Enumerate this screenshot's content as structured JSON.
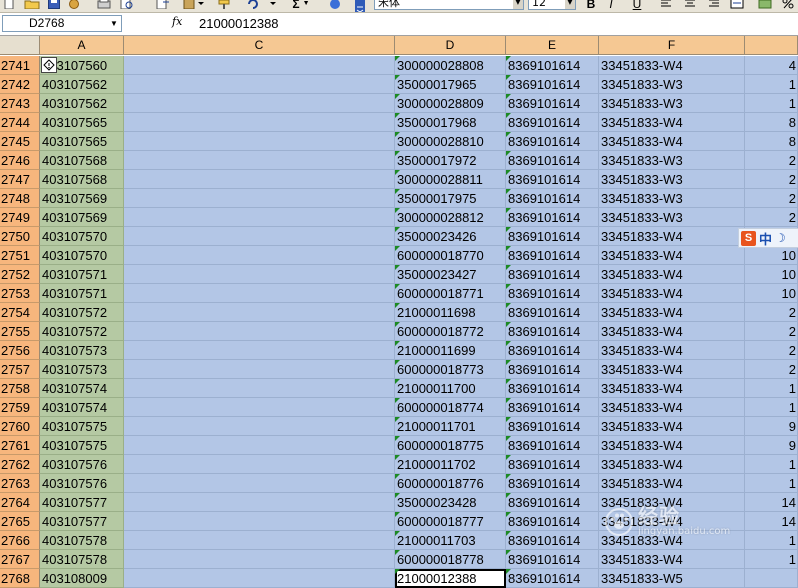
{
  "toolbar": {
    "font_name": "宋体",
    "font_size": "12",
    "bold_label": "B",
    "italic_label": "I",
    "underline_label": "U",
    "sum_label": "Σ"
  },
  "formula_bar": {
    "name_box": "D2768",
    "fx_label": "fx",
    "formula": "21000012388"
  },
  "columns": [
    "A",
    "C",
    "D",
    "E",
    "F",
    ""
  ],
  "rows": [
    {
      "n": "2741",
      "a": "403107560",
      "d": "300000028808",
      "e": "8369101614",
      "f": "33451833-W4",
      "g": "4"
    },
    {
      "n": "2742",
      "a": "403107562",
      "d": "35000017965",
      "e": "8369101614",
      "f": "33451833-W3",
      "g": "1"
    },
    {
      "n": "2743",
      "a": "403107562",
      "d": "300000028809",
      "e": "8369101614",
      "f": "33451833-W3",
      "g": "1"
    },
    {
      "n": "2744",
      "a": "403107565",
      "d": "35000017968",
      "e": "8369101614",
      "f": "33451833-W4",
      "g": "8"
    },
    {
      "n": "2745",
      "a": "403107565",
      "d": "300000028810",
      "e": "8369101614",
      "f": "33451833-W4",
      "g": "8"
    },
    {
      "n": "2746",
      "a": "403107568",
      "d": "35000017972",
      "e": "8369101614",
      "f": "33451833-W3",
      "g": "2"
    },
    {
      "n": "2747",
      "a": "403107568",
      "d": "300000028811",
      "e": "8369101614",
      "f": "33451833-W3",
      "g": "2"
    },
    {
      "n": "2748",
      "a": "403107569",
      "d": "35000017975",
      "e": "8369101614",
      "f": "33451833-W3",
      "g": "2"
    },
    {
      "n": "2749",
      "a": "403107569",
      "d": "300000028812",
      "e": "8369101614",
      "f": "33451833-W3",
      "g": "2"
    },
    {
      "n": "2750",
      "a": "403107570",
      "d": "35000023426",
      "e": "8369101614",
      "f": "33451833-W4",
      "g": ""
    },
    {
      "n": "2751",
      "a": "403107570",
      "d": "600000018770",
      "e": "8369101614",
      "f": "33451833-W4",
      "g": "10"
    },
    {
      "n": "2752",
      "a": "403107571",
      "d": "35000023427",
      "e": "8369101614",
      "f": "33451833-W4",
      "g": "10"
    },
    {
      "n": "2753",
      "a": "403107571",
      "d": "600000018771",
      "e": "8369101614",
      "f": "33451833-W4",
      "g": "10"
    },
    {
      "n": "2754",
      "a": "403107572",
      "d": "21000011698",
      "e": "8369101614",
      "f": "33451833-W4",
      "g": "2"
    },
    {
      "n": "2755",
      "a": "403107572",
      "d": "600000018772",
      "e": "8369101614",
      "f": "33451833-W4",
      "g": "2"
    },
    {
      "n": "2756",
      "a": "403107573",
      "d": "21000011699",
      "e": "8369101614",
      "f": "33451833-W4",
      "g": "2"
    },
    {
      "n": "2757",
      "a": "403107573",
      "d": "600000018773",
      "e": "8369101614",
      "f": "33451833-W4",
      "g": "2"
    },
    {
      "n": "2758",
      "a": "403107574",
      "d": "21000011700",
      "e": "8369101614",
      "f": "33451833-W4",
      "g": "1"
    },
    {
      "n": "2759",
      "a": "403107574",
      "d": "600000018774",
      "e": "8369101614",
      "f": "33451833-W4",
      "g": "1"
    },
    {
      "n": "2760",
      "a": "403107575",
      "d": "21000011701",
      "e": "8369101614",
      "f": "33451833-W4",
      "g": "9"
    },
    {
      "n": "2761",
      "a": "403107575",
      "d": "600000018775",
      "e": "8369101614",
      "f": "33451833-W4",
      "g": "9"
    },
    {
      "n": "2762",
      "a": "403107576",
      "d": "21000011702",
      "e": "8369101614",
      "f": "33451833-W4",
      "g": "1"
    },
    {
      "n": "2763",
      "a": "403107576",
      "d": "600000018776",
      "e": "8369101614",
      "f": "33451833-W4",
      "g": "1"
    },
    {
      "n": "2764",
      "a": "403107577",
      "d": "35000023428",
      "e": "8369101614",
      "f": "33451833-W4",
      "g": "14"
    },
    {
      "n": "2765",
      "a": "403107577",
      "d": "600000018777",
      "e": "8369101614",
      "f": "33451833-W4",
      "g": "14"
    },
    {
      "n": "2766",
      "a": "403107578",
      "d": "21000011703",
      "e": "8369101614",
      "f": "33451833-W4",
      "g": "1"
    },
    {
      "n": "2767",
      "a": "403107578",
      "d": "600000018778",
      "e": "8369101614",
      "f": "33451833-W4",
      "g": "1"
    },
    {
      "n": "2768",
      "a": "403108009",
      "d": "21000012388",
      "e": "8369101614",
      "f": "33451833-W5",
      "g": ""
    }
  ],
  "ime": {
    "zh_label": "中",
    "s_label": "S"
  },
  "watermark": {
    "main": "经验",
    "sub": "jingyan.baidu.com",
    "logo": "Bai-du-paw-logo"
  }
}
